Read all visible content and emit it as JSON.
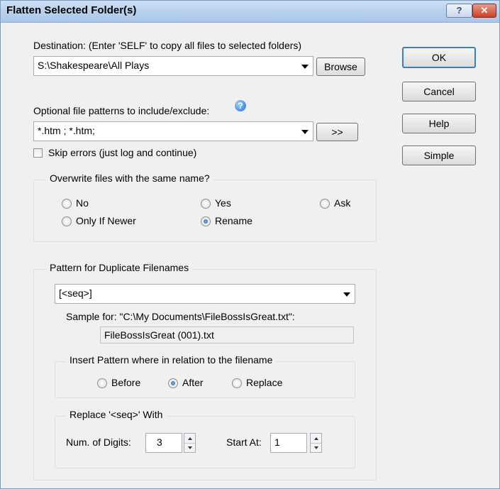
{
  "window": {
    "title": "Flatten Selected Folder(s)",
    "help_btn": "?",
    "close_btn": "✕"
  },
  "destination": {
    "label": "Destination: (Enter 'SELF' to copy all files to selected folders)",
    "value": "S:\\Shakespeare\\All Plays",
    "browse": "Browse"
  },
  "patterns": {
    "label": "Optional file patterns to include/exclude:",
    "value": "*.htm ; *.htm;",
    "expand": ">>"
  },
  "skip_errors": "Skip errors (just log and continue)",
  "overwrite": {
    "legend": "Overwrite files with the same name?",
    "options": [
      "No",
      "Yes",
      "Ask",
      "Only If Newer",
      "Rename"
    ],
    "selected": "Rename"
  },
  "duplicates": {
    "legend": "Pattern for Duplicate Filenames",
    "pattern": "[<seq>]",
    "sample_label": "Sample for: \"C:\\My Documents\\FileBossIsGreat.txt\":",
    "sample_value": "FileBossIsGreat (001).txt",
    "insert": {
      "legend": "Insert Pattern where in relation to the filename",
      "options": [
        "Before",
        "After",
        "Replace"
      ],
      "selected": "After"
    },
    "replace": {
      "legend": "Replace '<seq>' With",
      "digits_label": "Num. of Digits:",
      "digits_value": "3",
      "start_label": "Start At:",
      "start_value": "1"
    }
  },
  "buttons": {
    "ok": "OK",
    "cancel": "Cancel",
    "help": "Help",
    "simple": "Simple"
  }
}
